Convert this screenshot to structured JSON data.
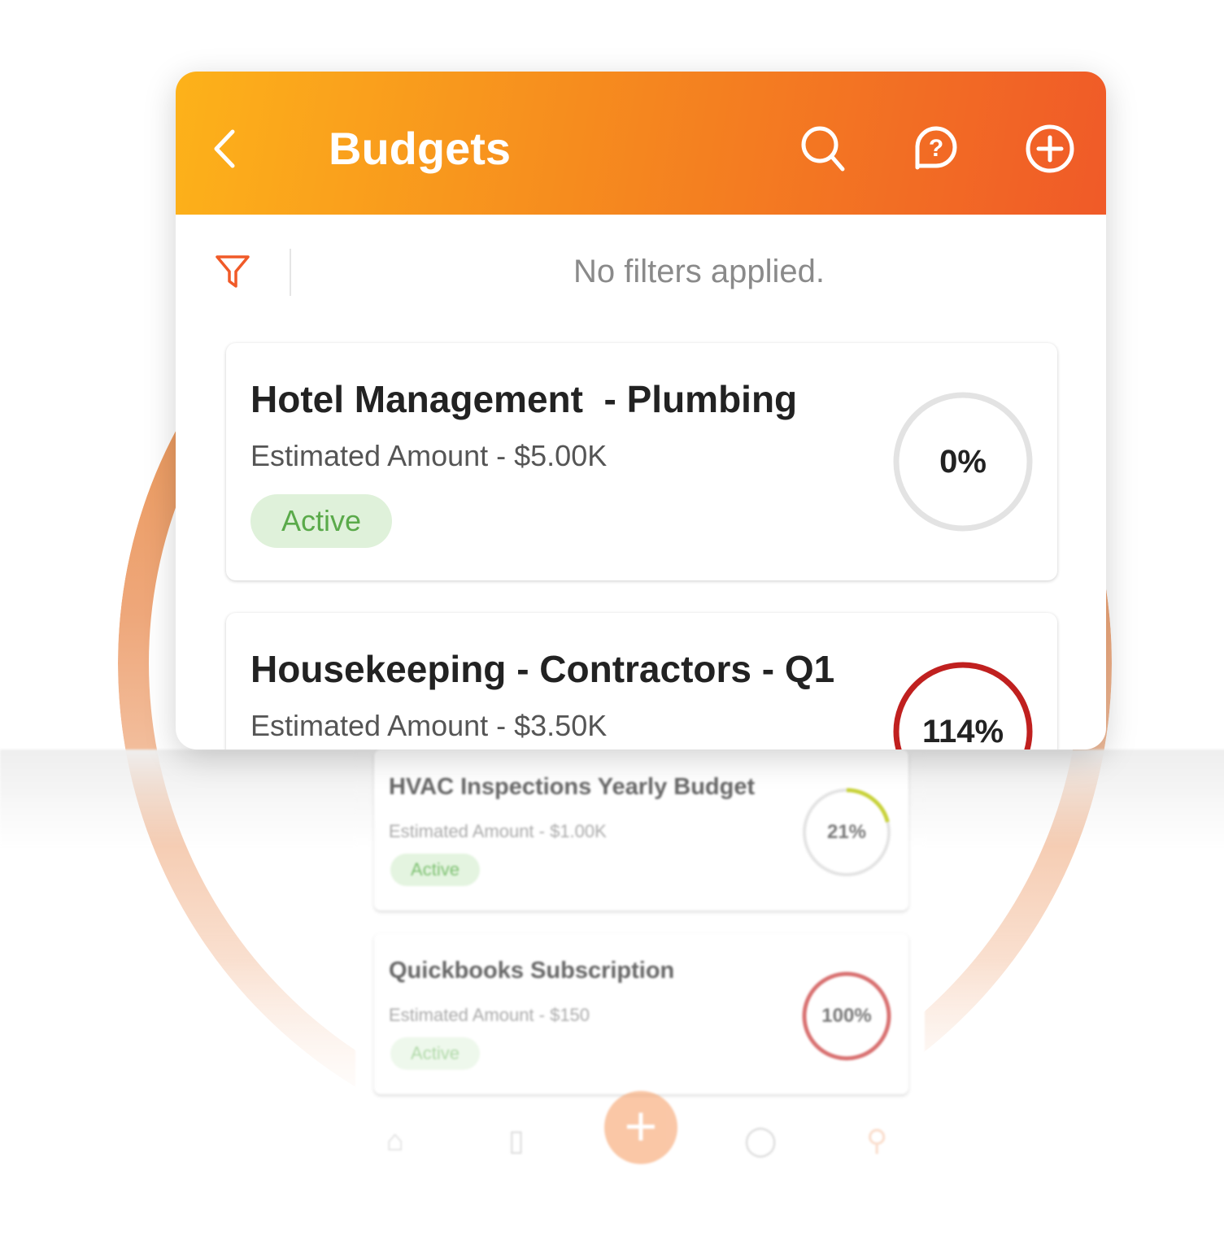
{
  "header": {
    "title": "Budgets"
  },
  "filter": {
    "text": "No filters applied."
  },
  "colors": {
    "accent": "#f5861f",
    "active_bg": "#dff1da",
    "active_text": "#5aaa4a",
    "over_budget": "#c0201f",
    "partial": "#c8d23a"
  },
  "budgets": [
    {
      "title": "Hotel Management  - Plumbing",
      "amount": "Estimated Amount - $5.00K",
      "status": "Active",
      "percent_label": "0%",
      "percent": 0
    },
    {
      "title": "Housekeeping - Contractors - Q1",
      "amount": "Estimated Amount - $3.50K",
      "percent_label": "114%",
      "percent": 114
    }
  ],
  "background_budgets": [
    {
      "title": "HVAC Inspections Yearly Budget",
      "amount": "Estimated Amount - $1.00K",
      "status": "Active",
      "percent_label": "21%",
      "percent": 21
    },
    {
      "title": "Quickbooks Subscription",
      "amount": "Estimated Amount - $150",
      "status": "Active",
      "percent_label": "100%",
      "percent": 100
    }
  ],
  "bottom_nav": {
    "icons": [
      "home-icon",
      "document-icon",
      "add-icon",
      "dollar-icon",
      "profile-icon"
    ]
  }
}
